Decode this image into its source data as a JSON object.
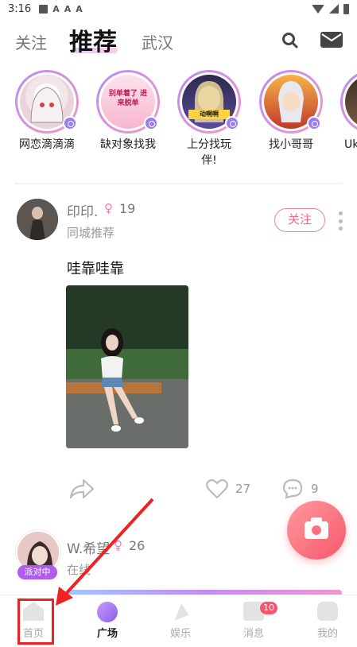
{
  "status_bar": {
    "time": "3:16"
  },
  "top_tabs": {
    "follow": "关注",
    "recommend": "推荐",
    "city": "武汉"
  },
  "stories": [
    {
      "label": "网恋滴滴滴"
    },
    {
      "label": "缺对象找我",
      "art_text": "别单着了 进来脱单"
    },
    {
      "label": "上分找玩伴!",
      "art_text": "动啊啊"
    },
    {
      "label": "找小哥哥"
    },
    {
      "label": "Uk"
    }
  ],
  "post1": {
    "name": "印印.",
    "gender_symbol": "♀",
    "age": "19",
    "sub": "同城推荐",
    "follow_label": "关注",
    "text": "哇靠哇靠",
    "likes": "27",
    "comments": "9"
  },
  "post2": {
    "name": "W.希望",
    "gender_symbol": "♀",
    "age": "26",
    "sub": "在线",
    "tag": "派对中"
  },
  "nav": {
    "home": "首页",
    "plaza": "广场",
    "entertainment": "娱乐",
    "messages": "消息",
    "messages_badge": "10",
    "me": "我的"
  },
  "colors": {
    "accent_pink": "#f5576c",
    "accent_purple": "#9b7df0",
    "annotation_red": "#e22222"
  }
}
